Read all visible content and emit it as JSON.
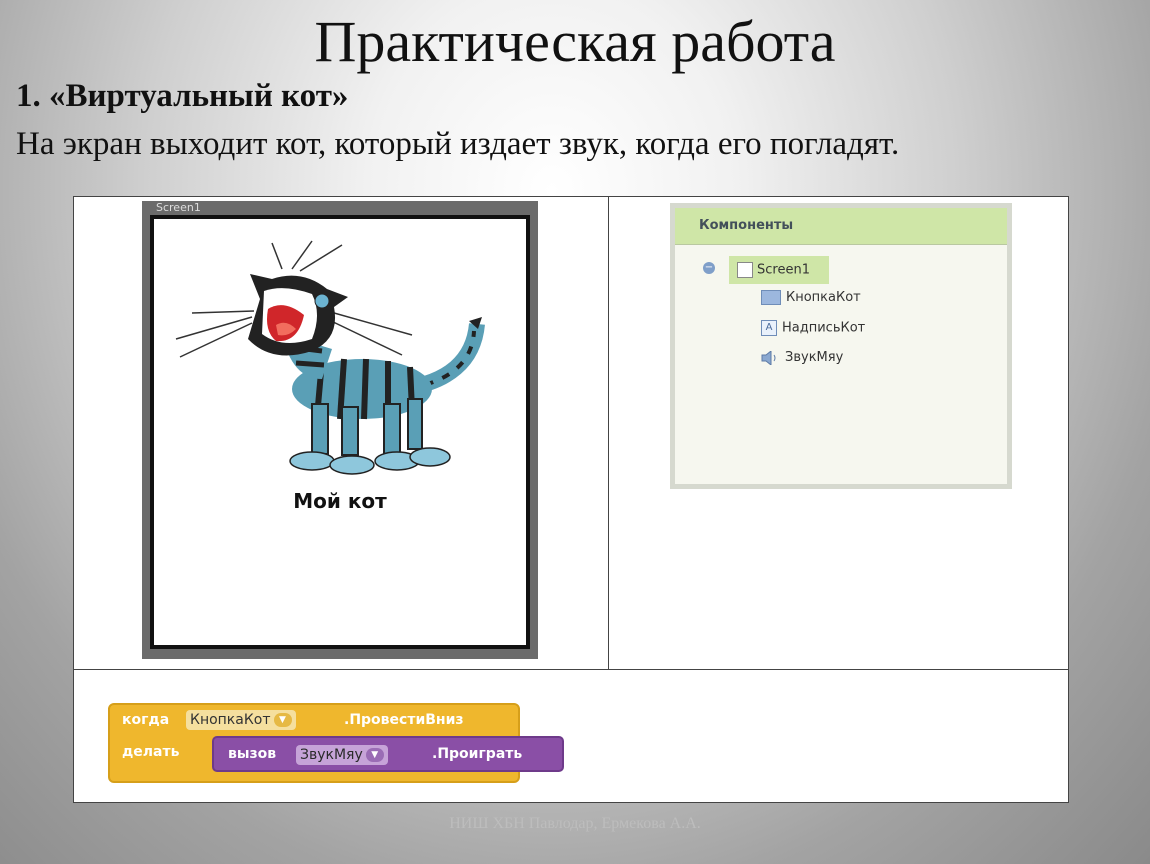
{
  "slide": {
    "title": "Практическая работа",
    "subtitle": "1. «Виртуальный кот»",
    "description": "На экран выходит кот, который издает звук, когда его погладят.",
    "footer": "НИШ ХБН Павлодар, Ермекова А.А."
  },
  "phone": {
    "screen_title": "Screen1",
    "caption": "Мой кот"
  },
  "components": {
    "header": "Компоненты",
    "root": "Screen1",
    "items": [
      {
        "label": "КнопкаКот",
        "icon": "button-icon"
      },
      {
        "label": "НадписьКот",
        "icon": "label-icon"
      },
      {
        "label": "ЗвукМяу",
        "icon": "sound-icon"
      }
    ]
  },
  "blocks": {
    "when_label": "когда",
    "event_component": "КнопкаКот",
    "event_name": ".ПровестиВниз",
    "do_label": "делать",
    "call_label": "вызов",
    "call_component": "ЗвукМяу",
    "call_method": ".Проиграть"
  }
}
